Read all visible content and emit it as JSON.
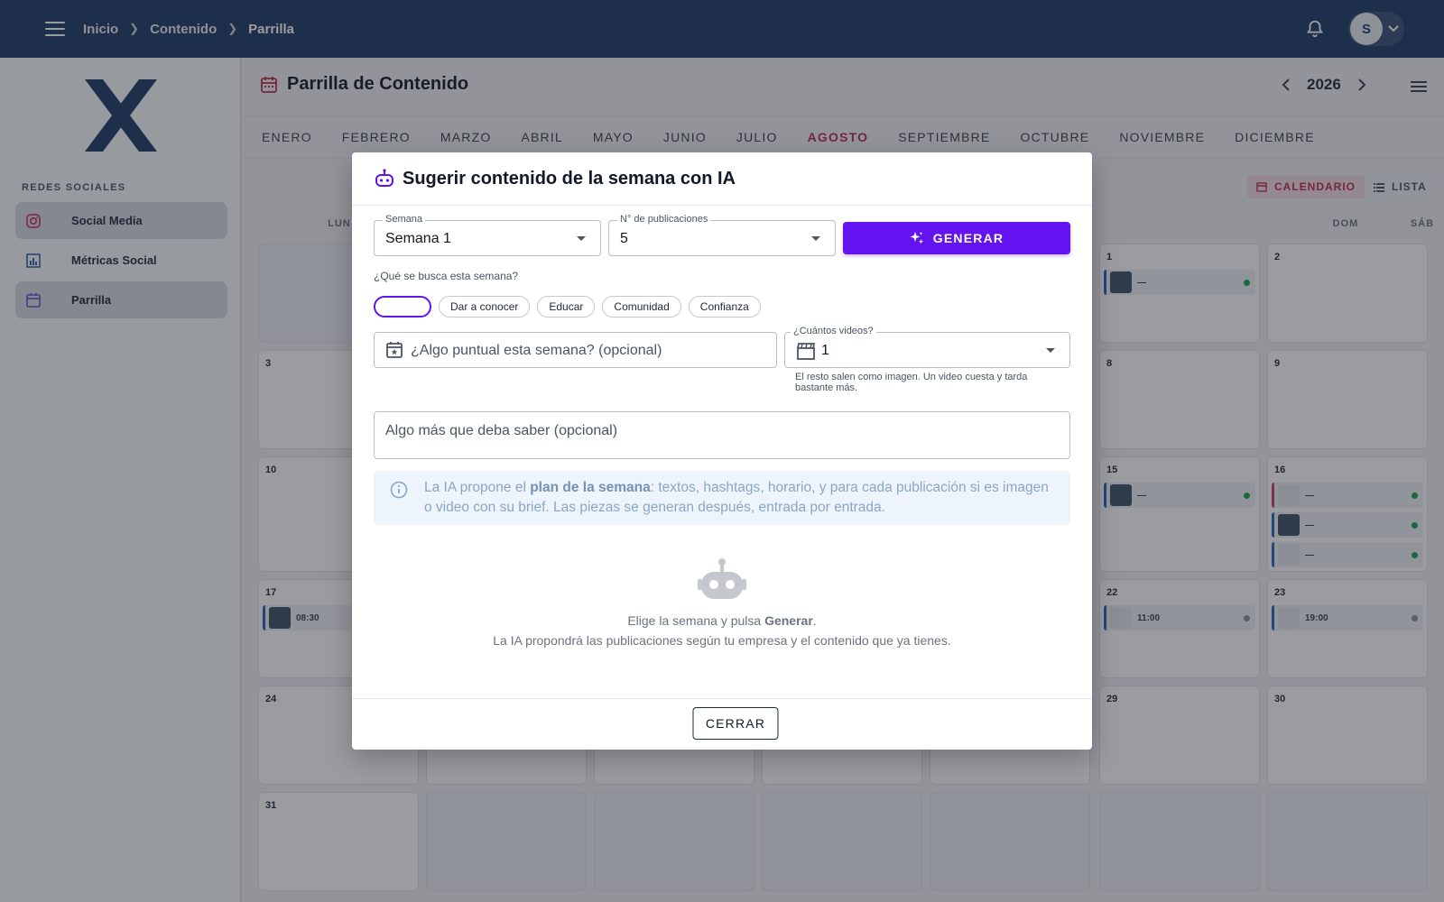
{
  "topbar": {
    "breadcrumbs": [
      "Inicio",
      "Contenido",
      "Parrilla"
    ],
    "avatar_initial": "S"
  },
  "sidebar": {
    "section_title": "REDES SOCIALES",
    "items": [
      {
        "label": "Social Media",
        "icon": "instagram-icon",
        "active": true
      },
      {
        "label": "Métricas Social",
        "icon": "bar-chart-icon",
        "active": false
      },
      {
        "label": "Parrilla",
        "icon": "calendar-icon",
        "active": true
      }
    ]
  },
  "page": {
    "title": "Parrilla de Contenido",
    "year": "2026",
    "months": [
      "ENERO",
      "FEBRERO",
      "MARZO",
      "ABRIL",
      "MAYO",
      "JUNIO",
      "JULIO",
      "AGOSTO",
      "SEPTIEMBRE",
      "OCTUBRE",
      "NOVIEMBRE",
      "DICIEMBRE"
    ],
    "active_month": "AGOSTO",
    "view_options": [
      "CALENDARIO",
      "LISTA"
    ],
    "weekdays_visible": [
      "LUN",
      "SÁB",
      "DOM"
    ]
  },
  "calendar": {
    "day_numbers": [
      "1",
      "2",
      "3",
      "8",
      "9",
      "10",
      "15",
      "16",
      "17",
      "22",
      "23",
      "24",
      "29",
      "30",
      "31"
    ],
    "posts": {
      "d1": "—",
      "d15": "—",
      "d16a": "—",
      "d16b": "—",
      "d16c": "—",
      "d17": "08:30",
      "d22": "11:00",
      "d23": "19:00"
    }
  },
  "dialog": {
    "title": "Sugerir contenido de la semana con IA",
    "semana": {
      "label": "Semana",
      "value": "Semana 1"
    },
    "publicaciones": {
      "label": "N° de publicaciones",
      "value": "5"
    },
    "generate_label": "GENERAR",
    "question": "¿Qué se busca esta semana?",
    "chips": [
      "",
      "Dar a conocer",
      "Educar",
      "Comunidad",
      "Confianza"
    ],
    "puntual_placeholder": "¿Algo puntual esta semana? (opcional)",
    "videos": {
      "label": "¿Cuántos videos?",
      "value": "1",
      "helper": "El resto salen como imagen. Un video cuesta y tarda bastante más."
    },
    "extra_placeholder": "Algo más que deba saber (opcional)",
    "info": {
      "pre": "La IA propone el ",
      "bold": "plan de la semana",
      "post": ": textos, hashtags, horario, y para cada publicación si es imagen o video con su brief. Las piezas se generan después, entrada por entrada."
    },
    "empty": {
      "line1_pre": "Elige la semana y pulsa ",
      "line1_bold": "Generar",
      "line1_post": ".",
      "line2": "La IA propondrá las publicaciones según tu empresa y el contenido que ya tienes."
    },
    "close_label": "CERRAR"
  },
  "colors": {
    "topbar": "#1e3a64",
    "accent": "#6312f0",
    "active_month": "#c0284f"
  }
}
